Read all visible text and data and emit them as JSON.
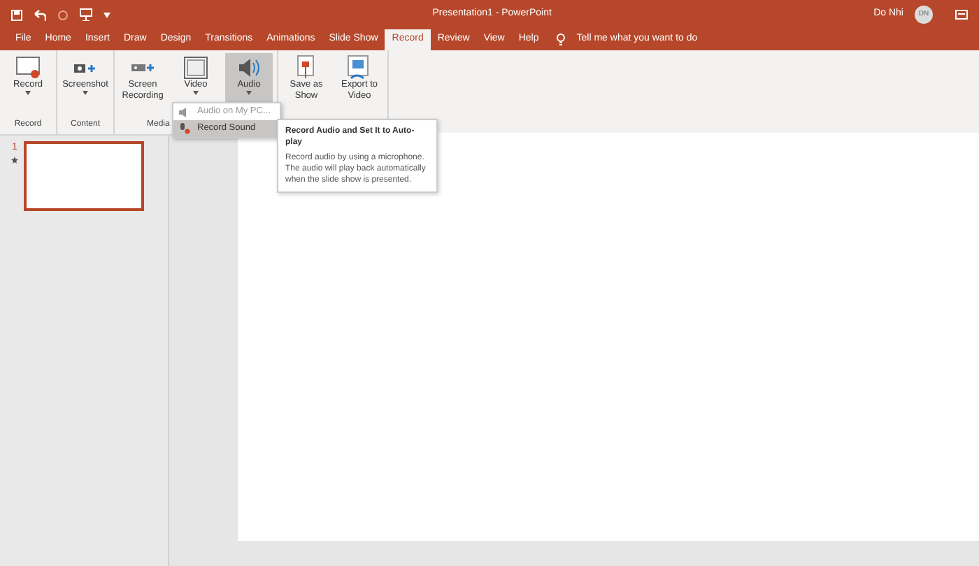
{
  "window": {
    "title": "Presentation1 - PowerPoint",
    "user": "Do Nhi",
    "avatar": "DN"
  },
  "tabs": [
    {
      "label": "File",
      "selected": false
    },
    {
      "label": "Home",
      "selected": false
    },
    {
      "label": "Insert",
      "selected": false
    },
    {
      "label": "Draw",
      "selected": false
    },
    {
      "label": "Design",
      "selected": false
    },
    {
      "label": "Transitions",
      "selected": false
    },
    {
      "label": "Animations",
      "selected": false
    },
    {
      "label": "Slide Show",
      "selected": false
    },
    {
      "label": "Record",
      "selected": true
    },
    {
      "label": "Review",
      "selected": false
    },
    {
      "label": "View",
      "selected": false
    },
    {
      "label": "Help",
      "selected": false
    }
  ],
  "tell_me": "Tell me what you want to do",
  "ribbon_groups": [
    {
      "label": "Record",
      "buttons": [
        {
          "label": "Record",
          "kind": "record",
          "dropdown": true,
          "selected": false
        }
      ]
    },
    {
      "label": "Content",
      "buttons": [
        {
          "label": "Screenshot",
          "kind": "screenshot",
          "dropdown": true,
          "selected": false
        }
      ]
    },
    {
      "label": "Media",
      "buttons": [
        {
          "label": "Screen Recording",
          "kind": "screenrec",
          "dropdown": false,
          "selected": false
        },
        {
          "label": "Video",
          "kind": "video",
          "dropdown": true,
          "selected": false
        },
        {
          "label": "Audio",
          "kind": "audio",
          "dropdown": true,
          "selected": true
        }
      ]
    },
    {
      "buttons": [
        {
          "label": "Save as Show",
          "kind": "show",
          "dropdown": false,
          "selected": false
        },
        {
          "label": "Export to Video",
          "kind": "export",
          "dropdown": false,
          "selected": false
        }
      ]
    }
  ],
  "audio_menu": [
    {
      "label": "Audio on My PC...",
      "disabled": true,
      "selected": false
    },
    {
      "label": "Record Sound",
      "disabled": false,
      "selected": true
    }
  ],
  "tooltip": {
    "title": "Record Audio and Set It to Auto-play",
    "text": "Record audio by using a microphone. The audio will play back automatically when the slide show is presented."
  },
  "slides": [
    {
      "number": "1",
      "selected": true
    }
  ]
}
